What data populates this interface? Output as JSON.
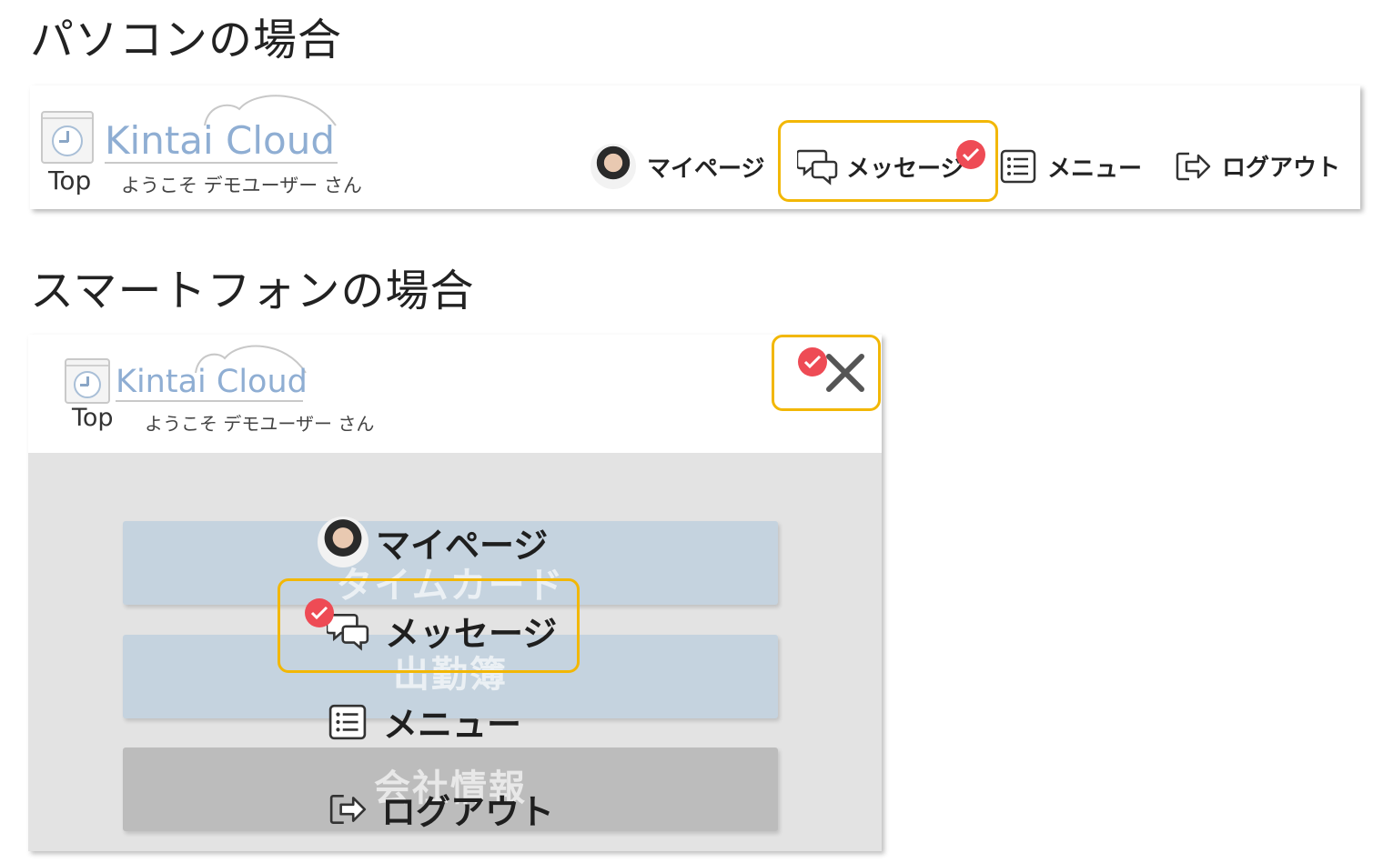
{
  "sections": {
    "pc_title": "パソコンの場合",
    "sp_title": "スマートフォンの場合"
  },
  "app": {
    "logo_text": "Kintai Cloud",
    "top_link": "Top",
    "welcome": "ようこそ デモユーザー さん"
  },
  "nav": {
    "mypage": "マイページ",
    "message": "メッセージ",
    "menu": "メニュー",
    "logout": "ログアウト"
  },
  "sp_background_buttons": {
    "timecard": "タイムカード",
    "attendance": "出勤簿",
    "company": "会社情報"
  },
  "colors": {
    "highlight": "#f2b705",
    "badge": "#ee4b55",
    "logo": "#8faed3",
    "sp_button_blue": "#c5d3df",
    "sp_button_gray": "#bcbcbc",
    "sp_overlay": "#e3e3e3"
  },
  "icons": {
    "avatar": "avatar-photo",
    "message": "speech-bubbles-icon",
    "menu": "list-icon",
    "logout": "exit-arrow-icon",
    "close": "close-x-icon",
    "badge": "check-badge-icon"
  }
}
